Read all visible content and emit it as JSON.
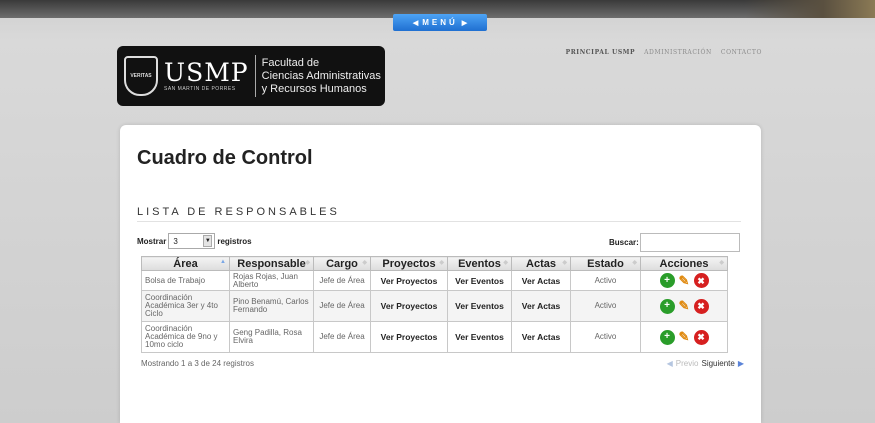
{
  "menu": {
    "label": "MENÚ"
  },
  "logo": {
    "name": "USMP",
    "subname": "SAN MARTIN DE PORRES",
    "shield_text": "VERITAS",
    "faculty_line1": "Facultad de",
    "faculty_line2": "Ciencias Administrativas",
    "faculty_line3": "y Recursos Humanos"
  },
  "top_nav": [
    {
      "label": "PRINCIPAL USMP"
    },
    {
      "label": "ADMINISTRACIÓN"
    },
    {
      "label": "CONTACTO"
    }
  ],
  "page": {
    "title": "Cuadro de Control",
    "section": "LISTA DE RESPONSABLES"
  },
  "controls": {
    "show_label": "Mostrar",
    "show_value": "3",
    "records_label": "registros",
    "search_label": "Buscar:",
    "search_value": ""
  },
  "table": {
    "headers": [
      "Área",
      "Responsable",
      "Cargo",
      "Proyectos",
      "Eventos",
      "Actas",
      "Estado",
      "Acciones"
    ],
    "rows": [
      {
        "area": "Bolsa de Trabajo",
        "responsable": "Rojas Rojas, Juan Alberto",
        "cargo": "Jefe de Área",
        "proyectos": "Ver Proyectos",
        "eventos": "Ver Eventos",
        "actas": "Ver Actas",
        "estado": "Activo"
      },
      {
        "area": "Coordinación Académica 3er y 4to Ciclo",
        "responsable": "Pino Benamú, Carlos Fernando",
        "cargo": "Jefe de Área",
        "proyectos": "Ver Proyectos",
        "eventos": "Ver Eventos",
        "actas": "Ver Actas",
        "estado": "Activo"
      },
      {
        "area": "Coordinación Académica de 9no y 10mo ciclo",
        "responsable": "Geng Padilla, Rosa Elvira",
        "cargo": "Jefe de Área",
        "proyectos": "Ver Proyectos",
        "eventos": "Ver Eventos",
        "actas": "Ver Actas",
        "estado": "Activo"
      }
    ]
  },
  "footer": {
    "info": "Mostrando 1 a 3 de 24 registros",
    "prev": "Previo",
    "next": "Siguiente"
  },
  "colors": {
    "menu_blue": "#1f6fd1",
    "add_green": "#2a9d2a",
    "delete_red": "#d62020",
    "edit_orange": "#e08a10"
  }
}
